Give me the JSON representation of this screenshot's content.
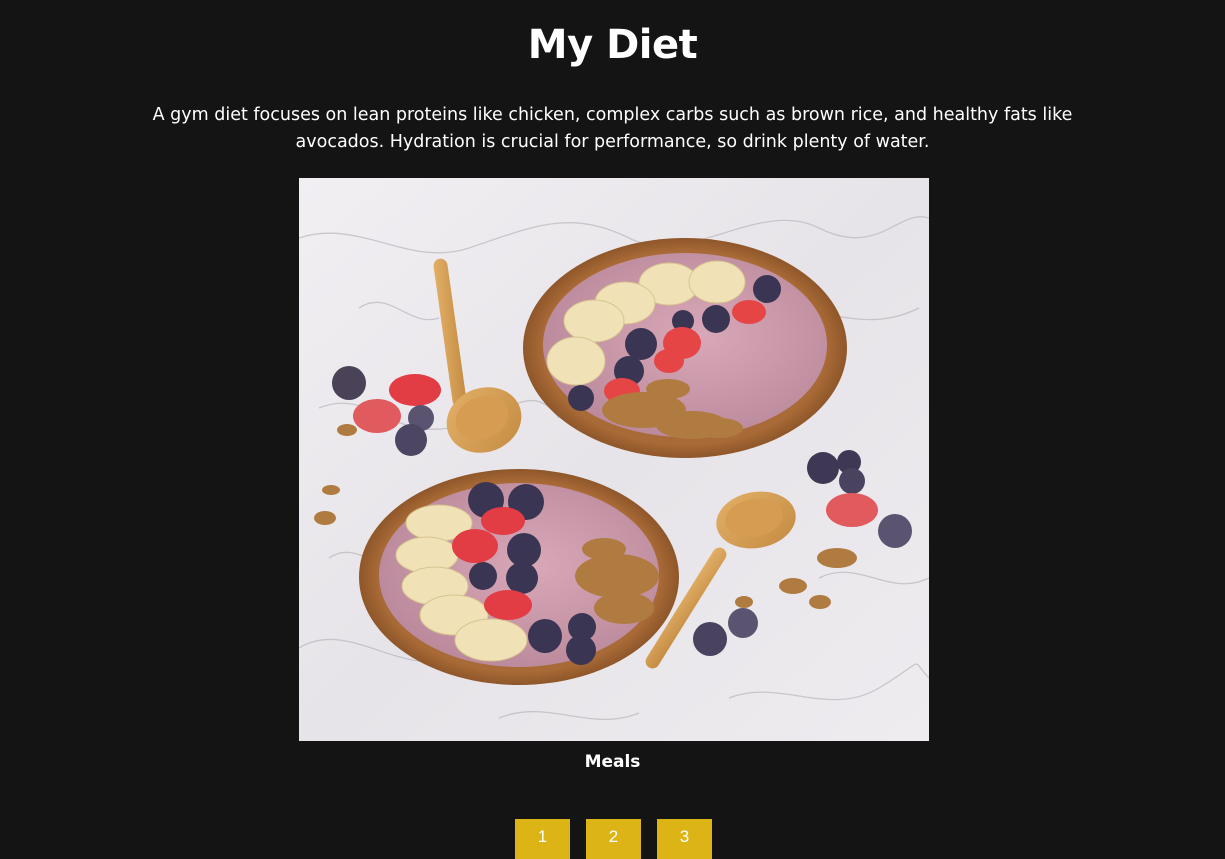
{
  "page": {
    "title": "My Diet",
    "intro": "A gym diet focuses on lean proteins like chicken, complex carbs such as brown rice, and healthy fats like avocados. Hydration is crucial for performance, so drink plenty of water."
  },
  "gallery": {
    "caption": "Meals",
    "image_subject": "two acai smoothie bowls with banana, strawberries, blueberries and granola on marble with wooden spoons",
    "pages": [
      "1",
      "2",
      "3"
    ]
  },
  "colors": {
    "background": "#141414",
    "accent": "#ddb416",
    "text": "#ffffff"
  }
}
